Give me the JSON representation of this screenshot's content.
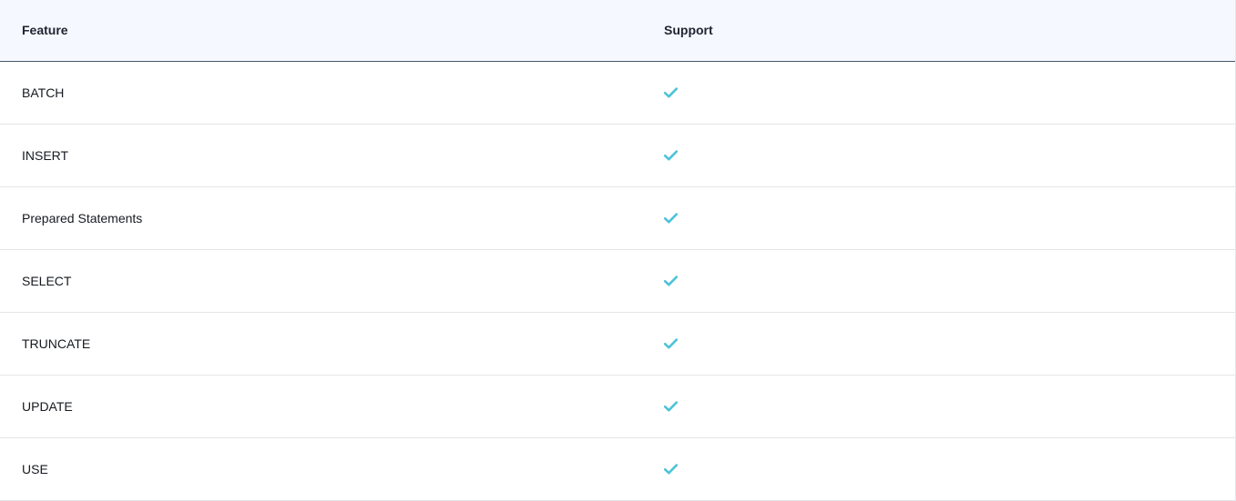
{
  "table": {
    "headers": [
      "Feature",
      "Support"
    ],
    "rows": [
      {
        "feature": "BATCH",
        "support": "check-icon"
      },
      {
        "feature": "INSERT",
        "support": "check-icon"
      },
      {
        "feature": "Prepared Statements",
        "support": "check-icon"
      },
      {
        "feature": "SELECT",
        "support": "check-icon"
      },
      {
        "feature": "TRUNCATE",
        "support": "check-icon"
      },
      {
        "feature": "UPDATE",
        "support": "check-icon"
      },
      {
        "feature": "USE",
        "support": "check-icon"
      }
    ]
  },
  "colors": {
    "header_background": "#f5f8fe",
    "header_border": "#46566b",
    "check": "#4cc3d9",
    "row_divider": "#e3e5e8"
  }
}
